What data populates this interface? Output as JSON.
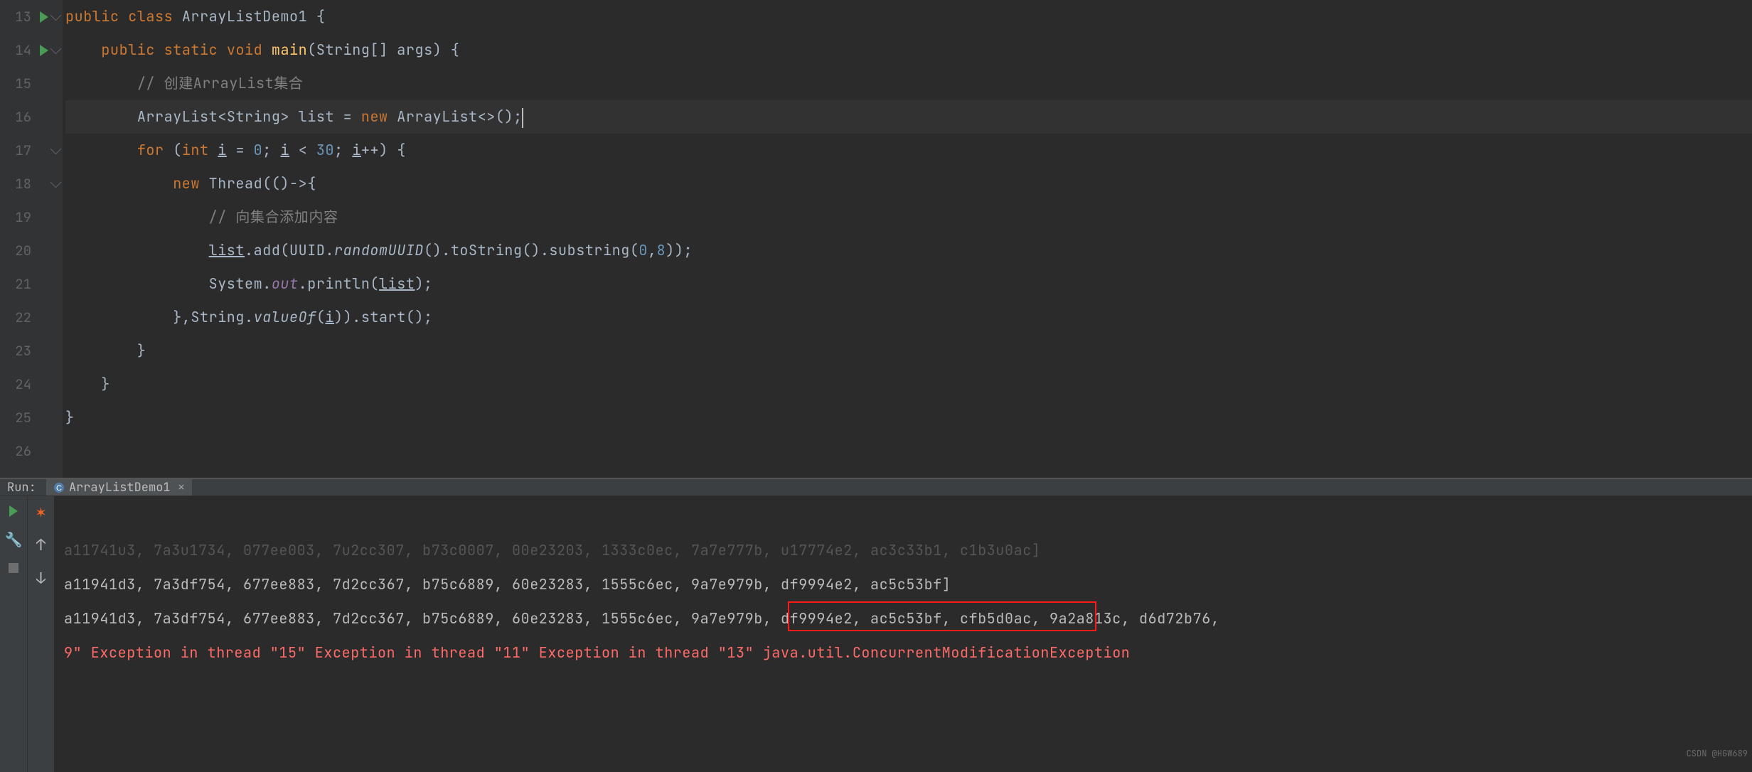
{
  "editor": {
    "lines": [
      {
        "num": 13,
        "run": true
      },
      {
        "num": 14,
        "run": true
      },
      {
        "num": 15
      },
      {
        "num": 16,
        "highlight": true
      },
      {
        "num": 17
      },
      {
        "num": 18
      },
      {
        "num": 19
      },
      {
        "num": 20
      },
      {
        "num": 21
      },
      {
        "num": 22
      },
      {
        "num": 23
      },
      {
        "num": 24
      },
      {
        "num": 25
      },
      {
        "num": 26
      }
    ],
    "code": {
      "kw_public": "public",
      "kw_class": "class",
      "kw_static": "static",
      "kw_void": "void",
      "kw_for": "for",
      "kw_int": "int",
      "kw_new": "new",
      "class_name": "ArrayListDemo1",
      "method_main": "main",
      "param_type": "String[]",
      "param_name": "args",
      "comment_create": "// 创建ArrayList集合",
      "arraylist": "ArrayList",
      "string": "String",
      "var_list": "list",
      "op_assign": " = ",
      "generic_empty": "<>();",
      "for_var": "i",
      "for_init": " = ",
      "num_0": "0",
      "for_cond": " < ",
      "num_30": "30",
      "for_inc": "++",
      "thread": "Thread",
      "lambda": "(()->{",
      "comment_add": "// 向集合添加内容",
      "add_method": ".add(UUID.",
      "randomUUID": "randomUUID",
      "toStr_sub": "().toString().substring(",
      "num_0b": "0",
      "comma": ",",
      "num_8": "8",
      "close_add": "));",
      "system": "System.",
      "out": "out",
      "println": ".println(",
      "list_ref": "list",
      "close_println": ");",
      "close_lambda": "},String.",
      "valueOf": "valueOf",
      "valueOf_arg": "(",
      "i_ref": "i",
      "close_start": ")).start();",
      "brace_close": "}"
    }
  },
  "run": {
    "label": "Run:",
    "tab_name": "ArrayListDemo1",
    "console_dim": "a11741u3, 7a3u1734, 077ee003, 7u2cc307, b73c0007, 00e23203, 1333c0ec, 7a7e777b, u17774e2, ac3c33b1, c1b3u0ac]",
    "console_l1": "a11941d3, 7a3df754, 677ee883, 7d2cc367, b75c6889, 60e23283, 1555c6ec, 9a7e979b, df9994e2, ac5c53bf]",
    "console_l2": "a11941d3, 7a3df754, 677ee883, 7d2cc367, b75c6889, 60e23283, 1555c6ec, 9a7e979b, df9994e2, ac5c53bf, cfb5d0ac, 9a2a813c, d6d72b76,",
    "console_err_a": "9\" Exception in thread \"15\" Exception in thread \"11\" Exception in thread \"13\" java.util.",
    "console_err_b": "ConcurrentModificationException"
  },
  "watermark": "CSDN @HGW689"
}
